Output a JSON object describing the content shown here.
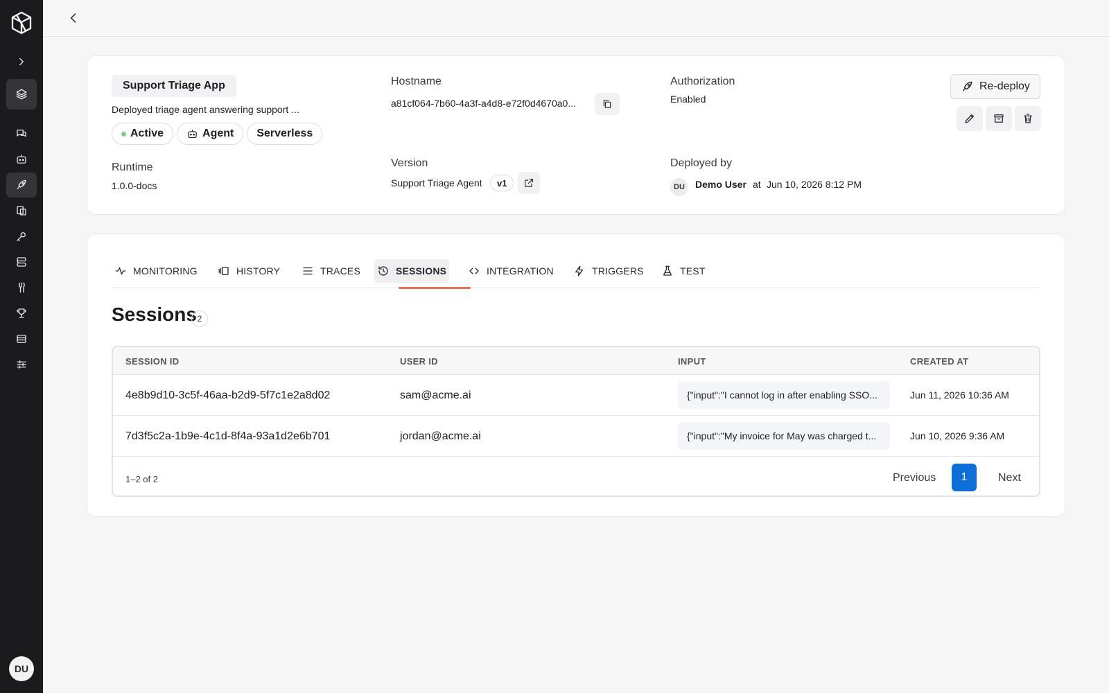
{
  "sidebar": {
    "logo": "brand-logo",
    "avatar_initials": "DU",
    "icons": [
      "expand-chevron-icon",
      "layers-icon",
      "chat-icon",
      "agent-icon",
      "rocket-icon",
      "documents-icon",
      "key-icon",
      "database-icon",
      "tools-icon",
      "trophy-icon",
      "table-icon",
      "sliders-icon"
    ]
  },
  "header": {
    "back_icon": "chevron-left-icon"
  },
  "app": {
    "name": "Support Triage App",
    "description": "Deployed triage agent answering support ...",
    "badges": {
      "status": "Active",
      "type": "Agent",
      "mode": "Serverless"
    },
    "hostname_label": "Hostname",
    "hostname_value": "a81cf064-7b60-4a3f-a4d8-e72f0d4670a0...",
    "authorization_label": "Authorization",
    "authorization_value": "Enabled",
    "runtime_label": "Runtime",
    "runtime_value": "1.0.0-docs",
    "version_label": "Version",
    "version_value": "Support Triage Agent",
    "version_badge": "v1",
    "deployed_by_label": "Deployed by",
    "deployed_by_initials": "DU",
    "deployed_by_name": "Demo User",
    "deployed_at_word": "at",
    "deployed_at": "Jun 10, 2026 8:12 PM",
    "redeploy_label": "Re-deploy",
    "status_color": "#7bd17f"
  },
  "tabs": [
    {
      "label": "MONITORING",
      "icon": "activity-icon"
    },
    {
      "label": "HISTORY",
      "icon": "history-icon"
    },
    {
      "label": "TRACES",
      "icon": "list-icon"
    },
    {
      "label": "SESSIONS",
      "icon": "clock-history-icon",
      "active": true
    },
    {
      "label": "INTEGRATION",
      "icon": "code-icon"
    },
    {
      "label": "TRIGGERS",
      "icon": "lightning-icon"
    },
    {
      "label": "TEST",
      "icon": "flask-icon"
    }
  ],
  "sessions": {
    "title": "Sessions",
    "count": "2",
    "columns": [
      "SESSION ID",
      "USER ID",
      "INPUT",
      "CREATED AT"
    ],
    "rows": [
      {
        "session_id": "4e8b9d10-3c5f-46aa-b2d9-5f7c1e2a8d02",
        "user_id": "sam@acme.ai",
        "input": "{\"input\":\"I cannot log in after enabling SSO...",
        "created_at": "Jun 11, 2026 10:36 AM"
      },
      {
        "session_id": "7d3f5c2a-1b9e-4c1d-8f4a-93a1d2e6b701",
        "user_id": "jordan@acme.ai",
        "input": "{\"input\":\"My invoice for May was charged t...",
        "created_at": "Jun 10, 2026 9:36 AM"
      }
    ],
    "range_text": "1–2 of 2",
    "prev_label": "Previous",
    "page": "1",
    "next_label": "Next",
    "accent_color": "#0f6fd9",
    "tab_accent_color": "#ef6b55"
  }
}
